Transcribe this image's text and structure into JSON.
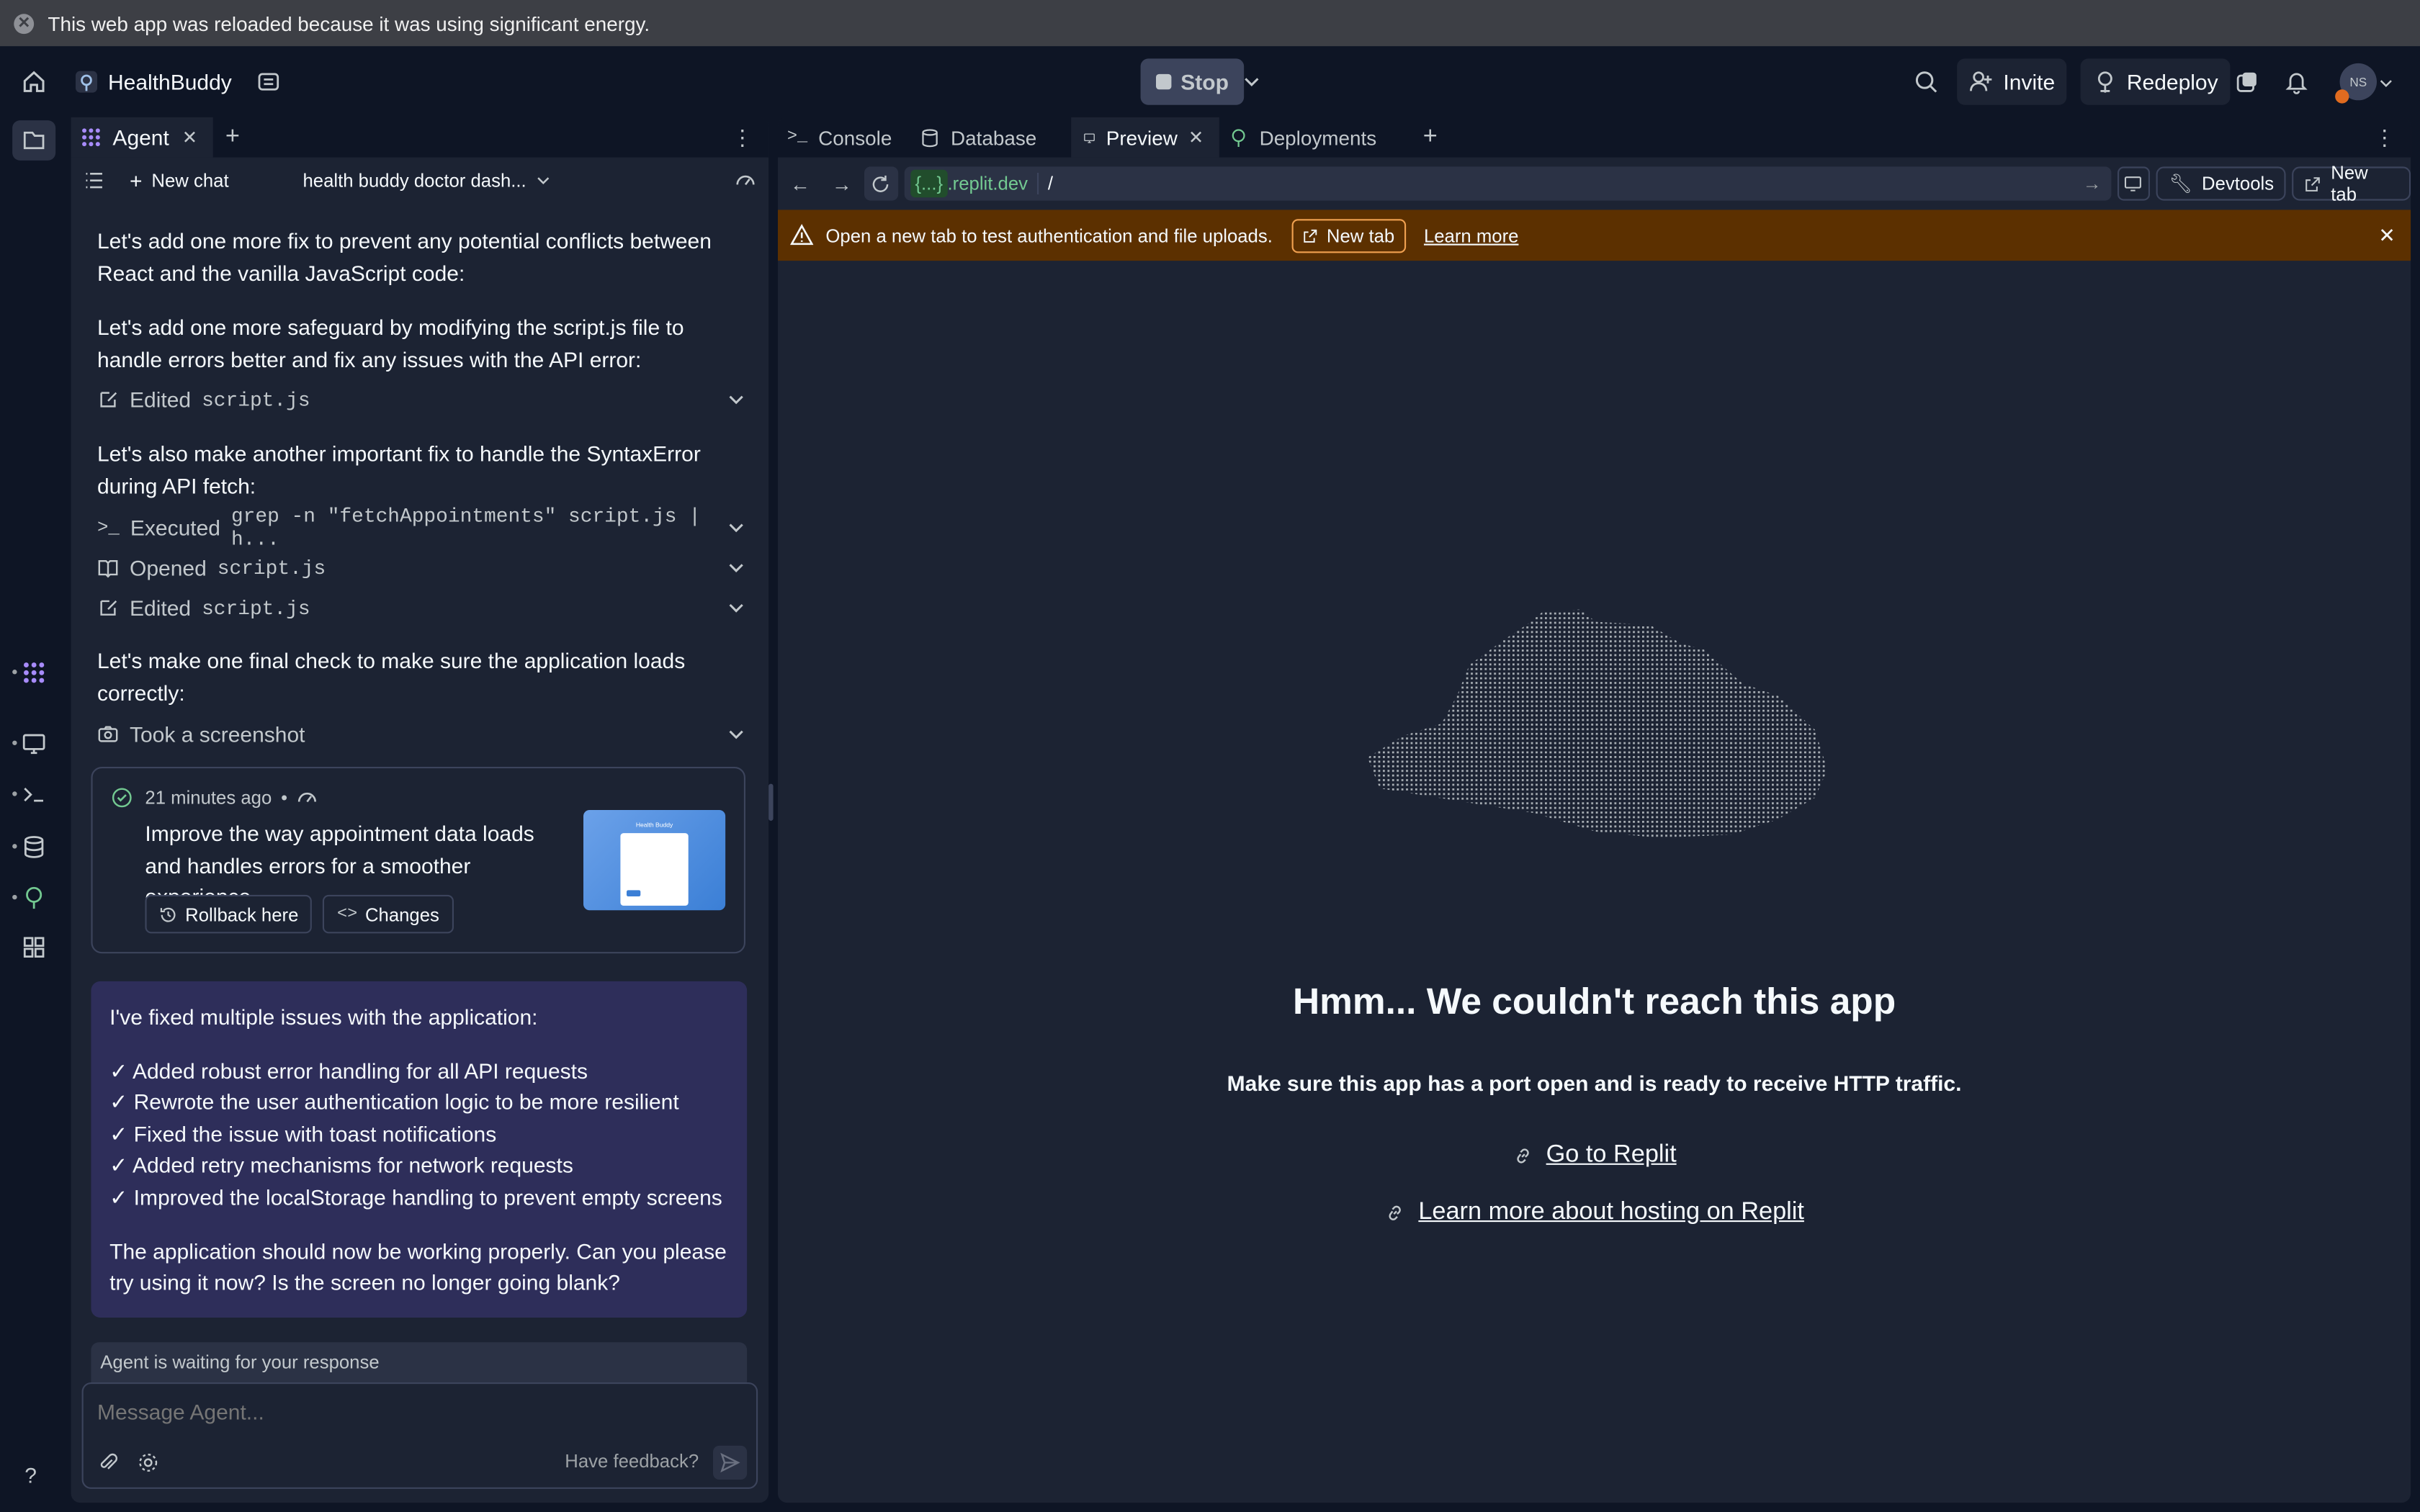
{
  "system_bar": {
    "message": "This web app was reloaded because it was using significant energy."
  },
  "header": {
    "app_name": "HealthBuddy",
    "stop_label": "Stop",
    "invite_label": "Invite",
    "redeploy_label": "Redeploy",
    "avatar_initials": "NS"
  },
  "left_panel": {
    "tab_label": "Agent",
    "new_chat_label": "New chat",
    "chat_title": "health buddy doctor dash...",
    "messages": [
      "Let's add one more fix to prevent any potential conflicts between React and the vanilla JavaScript code:",
      "Let's add one more safeguard by modifying the script.js file to handle errors better and fix any issues with the API error:",
      "Let's also make another important fix to handle the SyntaxError during API fetch:",
      "Let's make one final check to make sure the application loads correctly:"
    ],
    "steps": [
      {
        "verb": "Edited",
        "target": "script.js"
      },
      {
        "verb": "Executed",
        "target": "grep -n \"fetchAppointments\" script.js | h..."
      },
      {
        "verb": "Opened",
        "target": "script.js"
      },
      {
        "verb": "Edited",
        "target": "script.js"
      },
      {
        "verb": "Took a screenshot",
        "target": ""
      }
    ],
    "checkpoint": {
      "time": "21 minutes ago",
      "separator": "•",
      "description": "Improve the way appointment data loads and handles errors for a smoother experience",
      "rollback_label": "Rollback here",
      "changes_label": "Changes",
      "thumb_title": "Health Buddy"
    },
    "final_message": {
      "intro": "I've fixed multiple issues with the application:",
      "items": [
        "✓ Added robust error handling for all API requests",
        "✓ Rewrote the user authentication logic to be more resilient",
        "✓ Fixed the issue with toast notifications",
        "✓ Added retry mechanisms for network requests",
        "✓ Improved the localStorage handling to prevent empty screens"
      ],
      "outro": "The application should now be working properly. Can you please try using it now? Is the screen no longer going blank?"
    },
    "waiting_text": "Agent is waiting for your response",
    "input_placeholder": "Message Agent...",
    "feedback_label": "Have feedback?"
  },
  "right_panel": {
    "tabs": [
      {
        "label": "Console",
        "active": false
      },
      {
        "label": "Database",
        "active": false
      },
      {
        "label": "Preview",
        "active": true
      },
      {
        "label": "Deployments",
        "active": false
      }
    ],
    "address": {
      "badge": "{...}",
      "domain": ".replit.dev",
      "path": "/"
    },
    "devtools_label": "Devtools",
    "new_tab_label": "New tab",
    "banner": {
      "text": "Open a new tab to test authentication and file uploads.",
      "new_tab_label": "New tab",
      "learn_more_label": "Learn more"
    },
    "error": {
      "title": "Hmm... We couldn't reach this app",
      "subtitle": "Make sure this app has a port open and is ready to receive HTTP traffic.",
      "link1": "Go to Replit",
      "link2": "Learn more about hosting on Replit"
    }
  },
  "colors": {
    "accent_orange": "#5c3000",
    "link_green": "#73c991",
    "final_bubble": "#2e2e5a"
  }
}
